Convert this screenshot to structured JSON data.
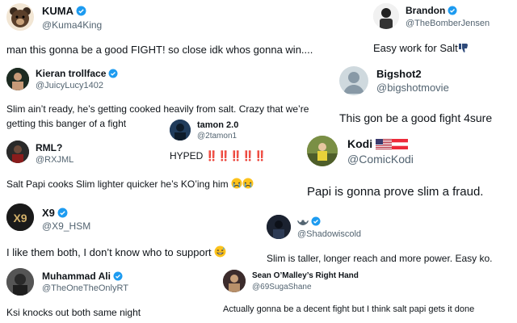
{
  "tweets": [
    {
      "name": "KUMA",
      "handle": "@Kuma4King",
      "text": "man this gonna be a good FIGHT! so close idk whos gonna win....",
      "verified": true
    },
    {
      "name": "Brandon",
      "handle": "@TheBomberJensen",
      "text": "Easy work for Salt",
      "verified": true
    },
    {
      "name": "Kieran trollface",
      "handle": "@JuicyLucy1402",
      "text1": "Slim ain’t ready, he’s getting cooked heavily from salt. Crazy that we’re",
      "text2": "getting this banger of a fight",
      "verified": true
    },
    {
      "name": "Bigshot2",
      "handle": "@bigshotmovie",
      "text": "This gon be a good fight 4sure",
      "verified": false
    },
    {
      "name": "tamon 2.0",
      "handle": "@2tamon1",
      "text": "HYPED ‼️‼️‼️‼️‼️",
      "verified": false
    },
    {
      "name": "RML?",
      "handle": "@RXJML",
      "text": "Salt Papi cooks Slim lighter quicker he’s KO’ing him",
      "verified": false
    },
    {
      "name": "Kodi",
      "handle": "@ComicKodi",
      "text": "Papi is gonna prove slim a fraud.",
      "verified": false
    },
    {
      "name": "X9",
      "handle": "@X9_HSM",
      "text": "I like them both, I don’t know who to support",
      "verified": true
    },
    {
      "name": "",
      "handle": "@Shadowiscold",
      "text": "Slim is taller, longer reach and more power. Easy ko.",
      "verified": true
    },
    {
      "name": "Muhammad Ali",
      "handle": "@TheOneTheOnlyRT",
      "text": "Ksi knocks out both same night",
      "verified": true
    },
    {
      "name": "Sean O’Malley’s Right Hand",
      "handle": "@69SugaShane",
      "text": "Actually gonna be a decent fight but I think salt papi gets it done",
      "verified": false
    }
  ],
  "colors": {
    "verified": "#1d9bf0",
    "handle": "#536471",
    "text": "#0f1419"
  },
  "icons": [
    "verified-badge-icon",
    "thumbs-down-icon",
    "crying-face-icon",
    "sweat-smile-icon",
    "us-flag-icon",
    "austria-flag-icon"
  ]
}
